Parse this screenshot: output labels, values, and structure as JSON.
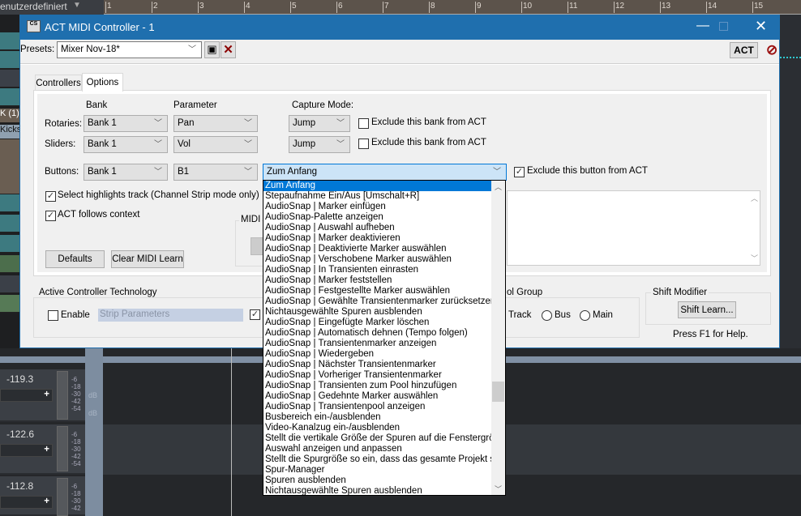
{
  "daw": {
    "preset_label": "enutzerdefiniert",
    "ruler": [
      "1",
      "2",
      "3",
      "4",
      "5",
      "6",
      "7",
      "8",
      "9",
      "10",
      "11",
      "12",
      "13",
      "14",
      "15"
    ],
    "left_tracks": [
      "K (1)",
      "Kicks"
    ],
    "tracks": [
      {
        "value": "-119.3"
      },
      {
        "value": "-122.6"
      },
      {
        "value": "-112.8"
      }
    ],
    "meter_scale": [
      "-6",
      "-18",
      "-30",
      "-42",
      "-54"
    ],
    "db_label": "dB"
  },
  "dialog": {
    "title": "ACT MIDI Controller - 1",
    "app_icon_text": "CS",
    "presets_label": "Presets:",
    "preset_value": "Mixer Nov-18*",
    "act_button": "ACT",
    "tabs": [
      {
        "label": "Controllers"
      },
      {
        "label": "Options"
      }
    ],
    "options": {
      "bank_header": "Bank",
      "parameter_header": "Parameter",
      "capture_header": "Capture Mode:",
      "rotaries": {
        "label": "Rotaries:",
        "bank": "Bank 1",
        "parameter": "Pan",
        "capture": "Jump",
        "exclude_label": "Exclude this bank from ACT",
        "exclude": false
      },
      "sliders": {
        "label": "Sliders:",
        "bank": "Bank 1",
        "parameter": "Vol",
        "capture": "Jump",
        "exclude_label": "Exclude this bank from ACT",
        "exclude": false
      },
      "buttons": {
        "label": "Buttons:",
        "bank": "Bank 1",
        "parameter": "B1",
        "action": "Zum Anfang",
        "exclude_label": "Exclude this button from ACT",
        "exclude": true
      },
      "select_highlights": {
        "label": "Select highlights track (Channel Strip mode only)",
        "checked": true
      },
      "act_follows": {
        "label": "ACT follows context",
        "checked": true
      },
      "midi_group": "MIDI",
      "defaults": "Defaults",
      "clear_midi_learn": "Clear MIDI Learn"
    },
    "act_group": {
      "title": "Active Controller Technology",
      "enable_label": "Enable",
      "enable": false,
      "strip_parameters": "Strip Parameters"
    },
    "control_group": {
      "title": "ol Group",
      "options": [
        "Track",
        "Bus",
        "Main"
      ]
    },
    "shift": {
      "title": "Shift Modifier",
      "button": "Shift Learn..."
    },
    "help": "Press F1 for Help."
  },
  "dropdown": {
    "selected": 0,
    "items": [
      "Zum Anfang",
      "Stepaufnahme Ein/Aus [Umschalt+R]",
      "AudioSnap | Marker einfügen",
      "AudioSnap-Palette anzeigen",
      "AudioSnap | Auswahl aufheben",
      "AudioSnap | Marker deaktivieren",
      "AudioSnap | Deaktivierte Marker auswählen",
      "AudioSnap | Verschobene Marker auswählen",
      "AudioSnap | In Transienten einrasten",
      "AudioSnap | Marker feststellen",
      "AudioSnap | Festgestellte Marker auswählen",
      "AudioSnap | Gewählte Transientenmarker zurücksetzen",
      "Nichtausgewählte Spuren ausblenden",
      "AudioSnap | Eingefügte Marker löschen",
      "AudioSnap | Automatisch dehnen (Tempo folgen)",
      "AudioSnap | Transientenmarker anzeigen",
      "AudioSnap | Wiedergeben",
      "AudioSnap | Nächster Transientenmarker",
      "AudioSnap | Vorheriger Transientenmarker",
      "AudioSnap | Transienten zum Pool hinzufügen",
      "AudioSnap | Gedehnte Marker auswählen",
      "AudioSnap | Transientenpool anzeigen",
      "Busbereich ein-/ausblenden",
      "Video-Kanalzug ein-/ausblenden",
      "Stellt die vertikale Größe der Spuren auf die Fenstergröße e",
      "Auswahl anzeigen und anpassen",
      "Stellt die Spurgröße so ein, dass das gesamte Projekt sichtb",
      "Spur-Manager",
      "Spuren ausblenden",
      "Nichtausgewählte Spuren ausblenden"
    ]
  },
  "colors": {
    "titlebar": "#1f6fae",
    "selection": "#0078d7",
    "dialog_bg": "#f0f0f0"
  }
}
